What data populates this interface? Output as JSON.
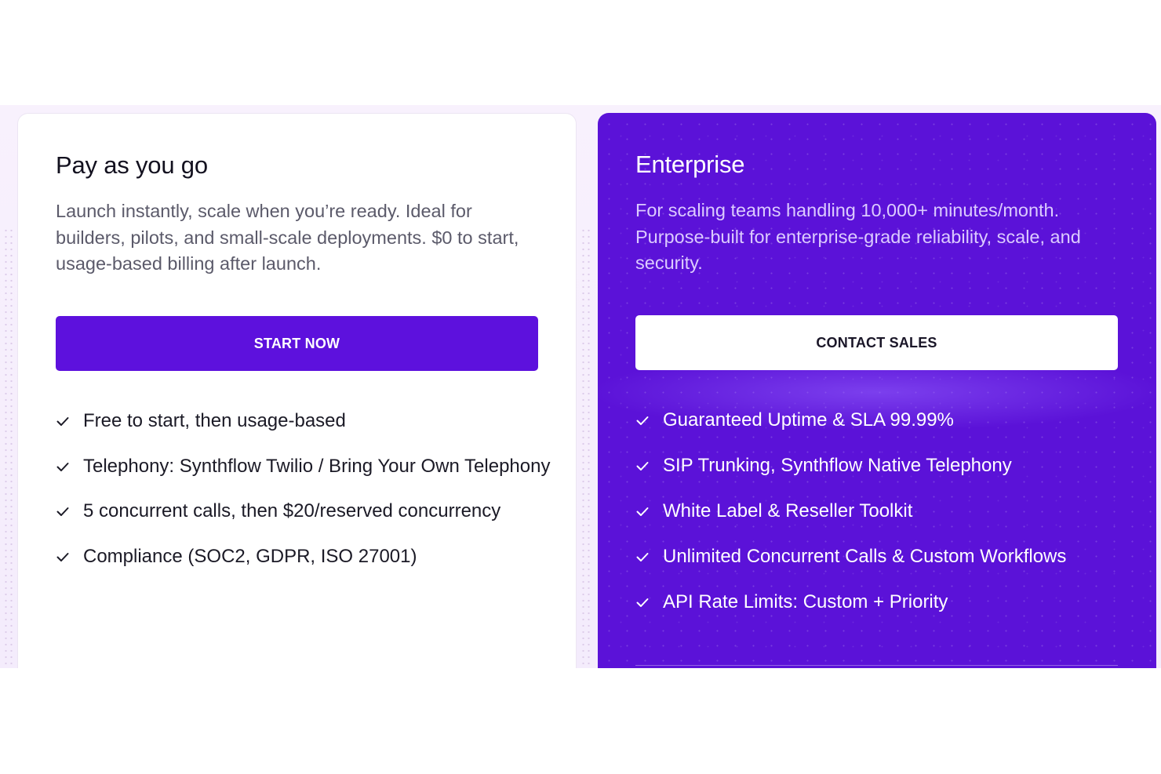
{
  "colors": {
    "accent": "#5d11dd",
    "enterprise_bg": "#5b12d8",
    "band_bg": "#f6eefc"
  },
  "payg": {
    "title": "Pay as you go",
    "description": "Launch instantly, scale when you’re ready. Ideal for builders, pilots, and small-scale deployments. $0 to start, usage-based billing after launch.",
    "cta_label": "START NOW",
    "features": [
      "Free to start, then usage-based",
      "Telephony: Synthflow Twilio / Bring Your Own Telephony",
      "5 concurrent calls, then $20/reserved concurrency",
      "Compliance (SOC2, GDPR, ISO 27001)"
    ]
  },
  "enterprise": {
    "title": "Enterprise",
    "description": "For scaling teams handling 10,000+ minutes/month. Purpose-built for enterprise-grade reliability, scale, and security.",
    "cta_label": "CONTACT SALES",
    "features": [
      "Guaranteed Uptime & SLA 99.99%",
      "SIP Trunking, Synthflow Native Telephony",
      "White Label & Reseller Toolkit",
      "Unlimited Concurrent Calls & Custom Workflows",
      "API Rate Limits: Custom + Priority"
    ]
  },
  "icons": {
    "feature_bullet": "check-icon"
  }
}
